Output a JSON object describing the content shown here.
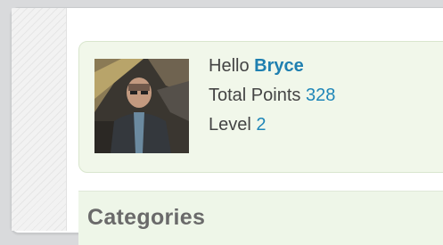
{
  "profile": {
    "greeting": "Hello",
    "username": "Bryce",
    "points_label": "Total Points",
    "points_value": "328",
    "level_label": "Level",
    "level_value": "2",
    "avatar_icon": "user-photo"
  },
  "sections": {
    "categories_title": "Categories"
  },
  "colors": {
    "accent_link": "#1f7fb0",
    "card_background": "#f1f7ea"
  }
}
